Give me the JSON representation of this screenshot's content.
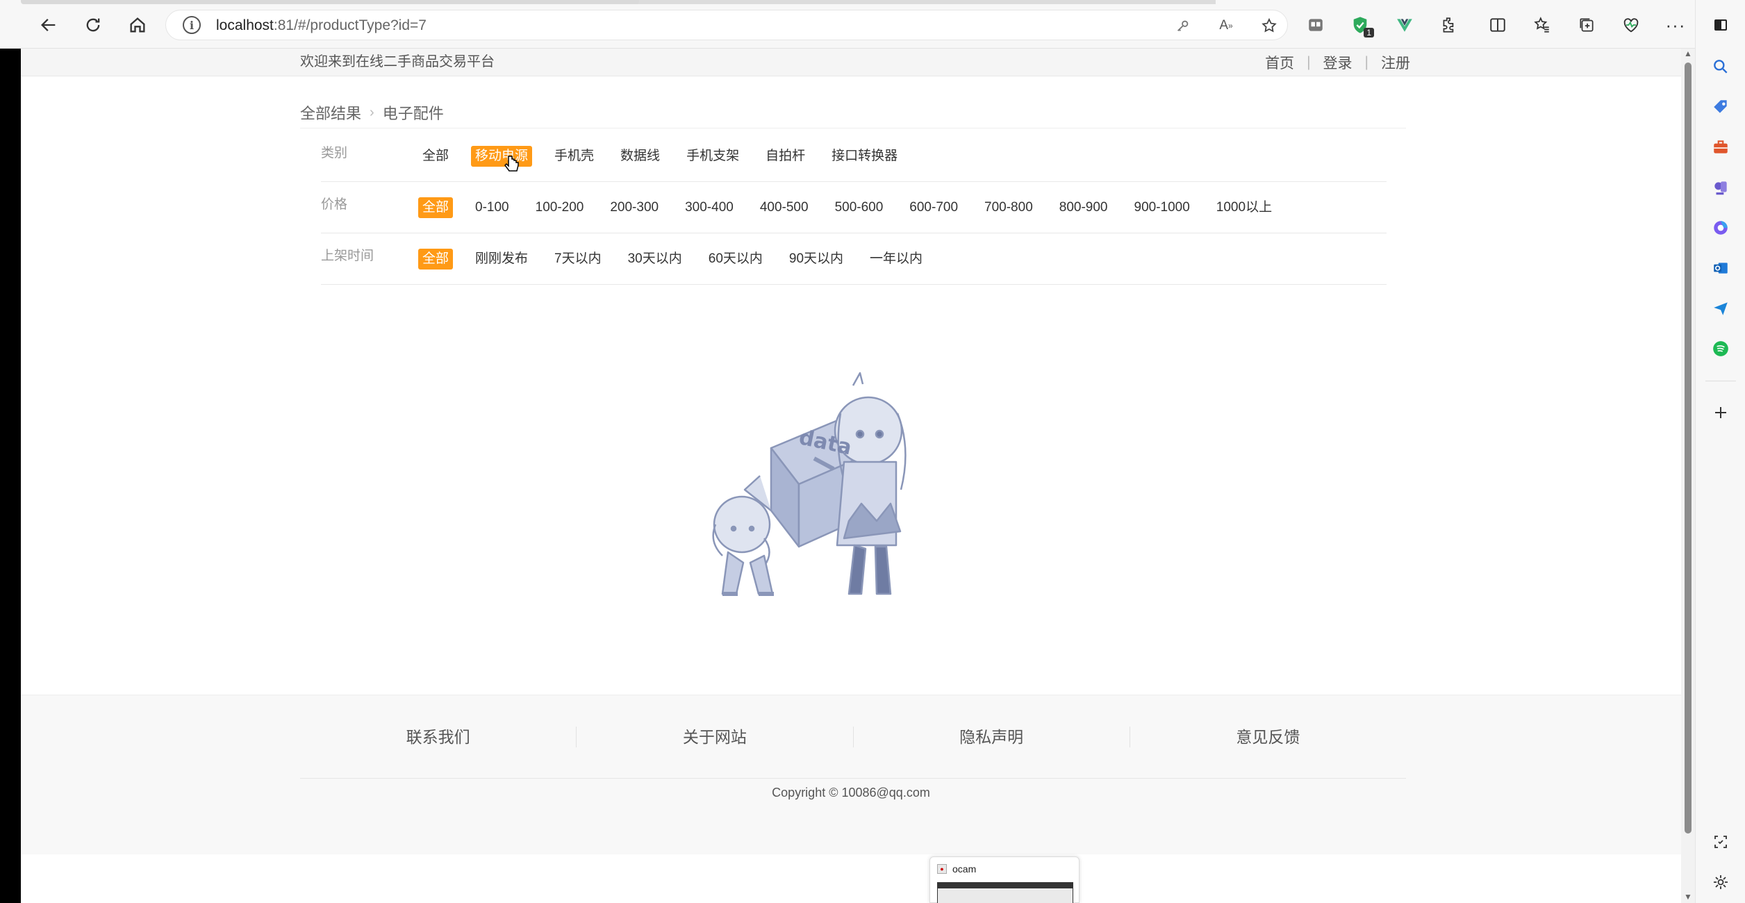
{
  "browser": {
    "url_host": "localhost",
    "url_rest": ":81/#/productType?id=7",
    "extension_badge": "1"
  },
  "header": {
    "welcome": "欢迎来到在线二手商品交易平台",
    "links": [
      "首页",
      "登录",
      "注册"
    ]
  },
  "breadcrumb": {
    "root": "全部结果",
    "current": "电子配件"
  },
  "filters": {
    "category": {
      "label": "类别",
      "options": [
        "全部",
        "移动电源",
        "手机壳",
        "数据线",
        "手机支架",
        "自拍杆",
        "接口转换器"
      ],
      "active_index": 1
    },
    "price": {
      "label": "价格",
      "options": [
        "全部",
        "0-100",
        "100-200",
        "200-300",
        "300-400",
        "400-500",
        "500-600",
        "600-700",
        "700-800",
        "800-900",
        "900-1000",
        "1000以上"
      ],
      "active_index": 0
    },
    "time": {
      "label": "上架时间",
      "options": [
        "全部",
        "刚刚发布",
        "7天以内",
        "30天以内",
        "60天以内",
        "90天以内",
        "一年以内"
      ],
      "active_index": 0
    }
  },
  "empty_state": {
    "box_text": "data"
  },
  "footer": {
    "links": [
      "联系我们",
      "关于网站",
      "隐私声明",
      "意见反馈"
    ],
    "copyright": "Copyright © 10086@qq.com"
  },
  "taskbar_popup": {
    "title": "ocam"
  },
  "colors": {
    "accent": "#ff9a16",
    "text": "#333333",
    "muted": "#999999",
    "illustration": "#9aa6c6"
  }
}
